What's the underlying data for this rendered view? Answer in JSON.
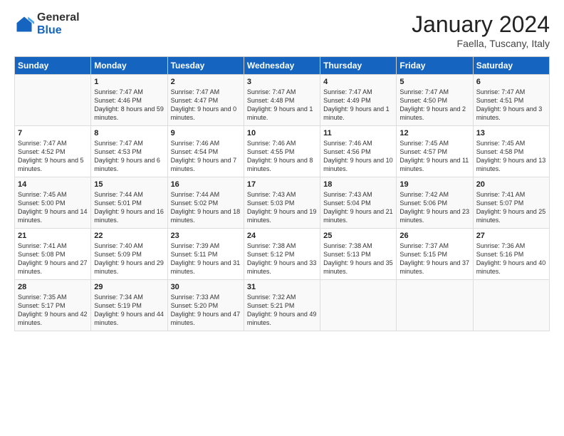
{
  "logo": {
    "general": "General",
    "blue": "Blue"
  },
  "title": "January 2024",
  "subtitle": "Faella, Tuscany, Italy",
  "days_header": [
    "Sunday",
    "Monday",
    "Tuesday",
    "Wednesday",
    "Thursday",
    "Friday",
    "Saturday"
  ],
  "weeks": [
    [
      {
        "num": "",
        "sunrise": "",
        "sunset": "",
        "daylight": ""
      },
      {
        "num": "1",
        "sunrise": "Sunrise: 7:47 AM",
        "sunset": "Sunset: 4:46 PM",
        "daylight": "Daylight: 8 hours and 59 minutes."
      },
      {
        "num": "2",
        "sunrise": "Sunrise: 7:47 AM",
        "sunset": "Sunset: 4:47 PM",
        "daylight": "Daylight: 9 hours and 0 minutes."
      },
      {
        "num": "3",
        "sunrise": "Sunrise: 7:47 AM",
        "sunset": "Sunset: 4:48 PM",
        "daylight": "Daylight: 9 hours and 1 minute."
      },
      {
        "num": "4",
        "sunrise": "Sunrise: 7:47 AM",
        "sunset": "Sunset: 4:49 PM",
        "daylight": "Daylight: 9 hours and 1 minute."
      },
      {
        "num": "5",
        "sunrise": "Sunrise: 7:47 AM",
        "sunset": "Sunset: 4:50 PM",
        "daylight": "Daylight: 9 hours and 2 minutes."
      },
      {
        "num": "6",
        "sunrise": "Sunrise: 7:47 AM",
        "sunset": "Sunset: 4:51 PM",
        "daylight": "Daylight: 9 hours and 3 minutes."
      }
    ],
    [
      {
        "num": "7",
        "sunrise": "Sunrise: 7:47 AM",
        "sunset": "Sunset: 4:52 PM",
        "daylight": "Daylight: 9 hours and 5 minutes."
      },
      {
        "num": "8",
        "sunrise": "Sunrise: 7:47 AM",
        "sunset": "Sunset: 4:53 PM",
        "daylight": "Daylight: 9 hours and 6 minutes."
      },
      {
        "num": "9",
        "sunrise": "Sunrise: 7:46 AM",
        "sunset": "Sunset: 4:54 PM",
        "daylight": "Daylight: 9 hours and 7 minutes."
      },
      {
        "num": "10",
        "sunrise": "Sunrise: 7:46 AM",
        "sunset": "Sunset: 4:55 PM",
        "daylight": "Daylight: 9 hours and 8 minutes."
      },
      {
        "num": "11",
        "sunrise": "Sunrise: 7:46 AM",
        "sunset": "Sunset: 4:56 PM",
        "daylight": "Daylight: 9 hours and 10 minutes."
      },
      {
        "num": "12",
        "sunrise": "Sunrise: 7:45 AM",
        "sunset": "Sunset: 4:57 PM",
        "daylight": "Daylight: 9 hours and 11 minutes."
      },
      {
        "num": "13",
        "sunrise": "Sunrise: 7:45 AM",
        "sunset": "Sunset: 4:58 PM",
        "daylight": "Daylight: 9 hours and 13 minutes."
      }
    ],
    [
      {
        "num": "14",
        "sunrise": "Sunrise: 7:45 AM",
        "sunset": "Sunset: 5:00 PM",
        "daylight": "Daylight: 9 hours and 14 minutes."
      },
      {
        "num": "15",
        "sunrise": "Sunrise: 7:44 AM",
        "sunset": "Sunset: 5:01 PM",
        "daylight": "Daylight: 9 hours and 16 minutes."
      },
      {
        "num": "16",
        "sunrise": "Sunrise: 7:44 AM",
        "sunset": "Sunset: 5:02 PM",
        "daylight": "Daylight: 9 hours and 18 minutes."
      },
      {
        "num": "17",
        "sunrise": "Sunrise: 7:43 AM",
        "sunset": "Sunset: 5:03 PM",
        "daylight": "Daylight: 9 hours and 19 minutes."
      },
      {
        "num": "18",
        "sunrise": "Sunrise: 7:43 AM",
        "sunset": "Sunset: 5:04 PM",
        "daylight": "Daylight: 9 hours and 21 minutes."
      },
      {
        "num": "19",
        "sunrise": "Sunrise: 7:42 AM",
        "sunset": "Sunset: 5:06 PM",
        "daylight": "Daylight: 9 hours and 23 minutes."
      },
      {
        "num": "20",
        "sunrise": "Sunrise: 7:41 AM",
        "sunset": "Sunset: 5:07 PM",
        "daylight": "Daylight: 9 hours and 25 minutes."
      }
    ],
    [
      {
        "num": "21",
        "sunrise": "Sunrise: 7:41 AM",
        "sunset": "Sunset: 5:08 PM",
        "daylight": "Daylight: 9 hours and 27 minutes."
      },
      {
        "num": "22",
        "sunrise": "Sunrise: 7:40 AM",
        "sunset": "Sunset: 5:09 PM",
        "daylight": "Daylight: 9 hours and 29 minutes."
      },
      {
        "num": "23",
        "sunrise": "Sunrise: 7:39 AM",
        "sunset": "Sunset: 5:11 PM",
        "daylight": "Daylight: 9 hours and 31 minutes."
      },
      {
        "num": "24",
        "sunrise": "Sunrise: 7:38 AM",
        "sunset": "Sunset: 5:12 PM",
        "daylight": "Daylight: 9 hours and 33 minutes."
      },
      {
        "num": "25",
        "sunrise": "Sunrise: 7:38 AM",
        "sunset": "Sunset: 5:13 PM",
        "daylight": "Daylight: 9 hours and 35 minutes."
      },
      {
        "num": "26",
        "sunrise": "Sunrise: 7:37 AM",
        "sunset": "Sunset: 5:15 PM",
        "daylight": "Daylight: 9 hours and 37 minutes."
      },
      {
        "num": "27",
        "sunrise": "Sunrise: 7:36 AM",
        "sunset": "Sunset: 5:16 PM",
        "daylight": "Daylight: 9 hours and 40 minutes."
      }
    ],
    [
      {
        "num": "28",
        "sunrise": "Sunrise: 7:35 AM",
        "sunset": "Sunset: 5:17 PM",
        "daylight": "Daylight: 9 hours and 42 minutes."
      },
      {
        "num": "29",
        "sunrise": "Sunrise: 7:34 AM",
        "sunset": "Sunset: 5:19 PM",
        "daylight": "Daylight: 9 hours and 44 minutes."
      },
      {
        "num": "30",
        "sunrise": "Sunrise: 7:33 AM",
        "sunset": "Sunset: 5:20 PM",
        "daylight": "Daylight: 9 hours and 47 minutes."
      },
      {
        "num": "31",
        "sunrise": "Sunrise: 7:32 AM",
        "sunset": "Sunset: 5:21 PM",
        "daylight": "Daylight: 9 hours and 49 minutes."
      },
      {
        "num": "",
        "sunrise": "",
        "sunset": "",
        "daylight": ""
      },
      {
        "num": "",
        "sunrise": "",
        "sunset": "",
        "daylight": ""
      },
      {
        "num": "",
        "sunrise": "",
        "sunset": "",
        "daylight": ""
      }
    ]
  ]
}
